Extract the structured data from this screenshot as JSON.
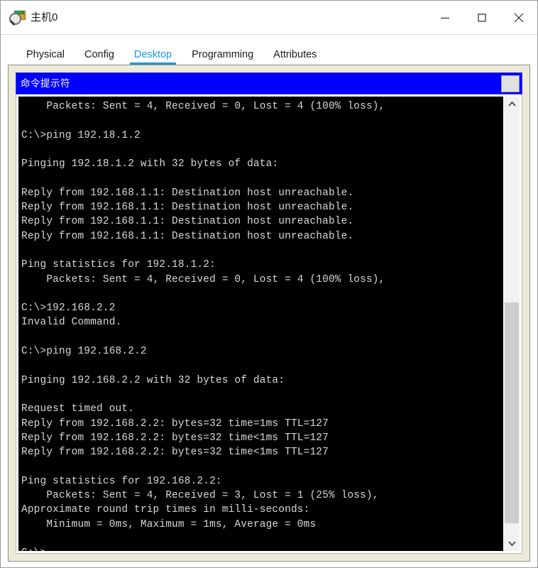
{
  "window": {
    "title": "主机0",
    "icon": "packet-tracer-host-icon",
    "controls": {
      "minimize": "minimize-icon",
      "maximize": "maximize-icon",
      "close": "close-icon"
    }
  },
  "tabs": [
    {
      "label": "Physical",
      "active": false
    },
    {
      "label": "Config",
      "active": false
    },
    {
      "label": "Desktop",
      "active": true
    },
    {
      "label": "Programming",
      "active": false
    },
    {
      "label": "Attributes",
      "active": false
    }
  ],
  "command_prompt": {
    "title": "命令提示符",
    "close_button_label": "",
    "lines": [
      "    Packets: Sent = 4, Received = 0, Lost = 4 (100% loss),",
      "",
      "C:\\>ping 192.18.1.2",
      "",
      "Pinging 192.18.1.2 with 32 bytes of data:",
      "",
      "Reply from 192.168.1.1: Destination host unreachable.",
      "Reply from 192.168.1.1: Destination host unreachable.",
      "Reply from 192.168.1.1: Destination host unreachable.",
      "Reply from 192.168.1.1: Destination host unreachable.",
      "",
      "Ping statistics for 192.18.1.2:",
      "    Packets: Sent = 4, Received = 0, Lost = 4 (100% loss),",
      "",
      "C:\\>192.168.2.2",
      "Invalid Command.",
      "",
      "C:\\>ping 192.168.2.2",
      "",
      "Pinging 192.168.2.2 with 32 bytes of data:",
      "",
      "Request timed out.",
      "Reply from 192.168.2.2: bytes=32 time=1ms TTL=127",
      "Reply from 192.168.2.2: bytes=32 time<1ms TTL=127",
      "Reply from 192.168.2.2: bytes=32 time<1ms TTL=127",
      "",
      "Ping statistics for 192.168.2.2:",
      "    Packets: Sent = 4, Received = 3, Lost = 1 (25% loss),",
      "Approximate round trip times in milli-seconds:",
      "    Minimum = 0ms, Maximum = 1ms, Average = 0ms",
      "",
      "C:\\>"
    ]
  },
  "scrollbar": {
    "up_arrow": "chevron-up-icon",
    "down_arrow": "chevron-down-icon",
    "thumb_top_percent": 45,
    "thumb_height_percent": 52
  },
  "colors": {
    "accent": "#1a9bd7",
    "cmd_titlebar": "#0000ff",
    "panel_bg": "#ece9d8",
    "terminal_bg": "#000000",
    "terminal_fg": "#d9d9d9"
  }
}
